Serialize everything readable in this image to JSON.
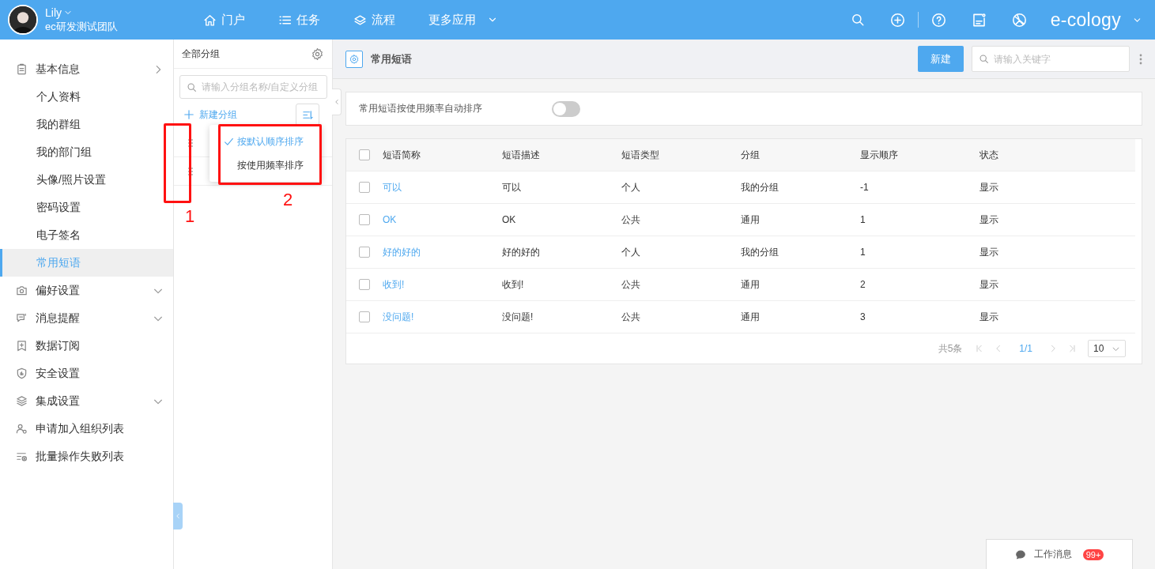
{
  "topbar": {
    "user": {
      "name": "Lily",
      "team": "ec研发测试团队"
    },
    "nav": [
      {
        "label": "门户"
      },
      {
        "label": "任务"
      },
      {
        "label": "流程"
      },
      {
        "label": "更多应用"
      }
    ],
    "brand": "e-cology"
  },
  "sidebar": {
    "items": [
      {
        "label": "基本信息",
        "selected": false,
        "kind": "expanded",
        "children": [
          {
            "label": "个人资料",
            "selected": false
          },
          {
            "label": "我的群组",
            "selected": false
          },
          {
            "label": "我的部门组",
            "selected": false
          },
          {
            "label": "头像/照片设置",
            "selected": false
          },
          {
            "label": "密码设置",
            "selected": false
          },
          {
            "label": "电子签名",
            "selected": false
          },
          {
            "label": "常用短语",
            "selected": true
          }
        ]
      },
      {
        "label": "偏好设置",
        "selected": false,
        "kind": "collapsed"
      },
      {
        "label": "消息提醒",
        "selected": false,
        "kind": "collapsed"
      },
      {
        "label": "数据订阅",
        "selected": false
      },
      {
        "label": "安全设置",
        "selected": false
      },
      {
        "label": "集成设置",
        "selected": false,
        "kind": "collapsed"
      },
      {
        "label": "申请加入组织列表",
        "selected": false
      },
      {
        "label": "批量操作失败列表",
        "selected": false
      }
    ]
  },
  "group_panel": {
    "title": "全部分组",
    "search": {
      "placeholder": "请输入分组名称/自定义分组"
    },
    "new_group": "新建分组",
    "groups": [
      {
        "selected": false
      },
      {
        "selected": false
      }
    ],
    "sort_menu": [
      {
        "label": "按默认顺序排序",
        "selected": true
      },
      {
        "label": "按使用频率排序",
        "selected": false
      }
    ]
  },
  "annotations": [
    {
      "label": "1"
    },
    {
      "label": "2"
    }
  ],
  "main": {
    "title": "常用短语",
    "new_button": "新建",
    "search": {
      "placeholder": "请输入关键字"
    },
    "auto_sort": {
      "label": "常用短语按使用频率自动排序",
      "on": false
    },
    "table": {
      "select_all": false,
      "columns": [
        "短语简称",
        "短语描述",
        "短语类型",
        "分组",
        "显示顺序",
        "状态"
      ],
      "rows": [
        {
          "checked": false,
          "cells": [
            "可以",
            "可以",
            "个人",
            "我的分组",
            "-1",
            "显示"
          ]
        },
        {
          "checked": false,
          "cells": [
            "OK",
            "OK",
            "公共",
            "通用",
            "1",
            "显示"
          ]
        },
        {
          "checked": false,
          "cells": [
            "好的好的",
            "好的好的",
            "个人",
            "我的分组",
            "1",
            "显示"
          ]
        },
        {
          "checked": false,
          "cells": [
            "收到!",
            "收到!",
            "公共",
            "通用",
            "2",
            "显示"
          ]
        },
        {
          "checked": false,
          "cells": [
            "没问题!",
            "没问题!",
            "公共",
            "通用",
            "3",
            "显示"
          ]
        }
      ]
    },
    "pagination": {
      "total": "共5条",
      "page": "1/1",
      "page_size": "10"
    }
  },
  "work_messages": {
    "label": "工作消息",
    "badge": "99+"
  }
}
